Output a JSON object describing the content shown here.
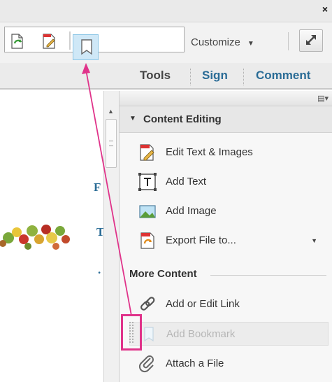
{
  "window": {
    "close_label": "×"
  },
  "toolbar": {
    "customize_label": "Customize",
    "customize_arrow": "▼",
    "icons": [
      "refresh-document-icon",
      "edit-document-icon",
      "bookmark-icon",
      "expand-icon"
    ]
  },
  "tabs": {
    "tools": "Tools",
    "sign": "Sign",
    "comment": "Comment"
  },
  "document": {
    "letters": [
      "F",
      "T",
      "."
    ]
  },
  "panel": {
    "options_icon": "▤▾",
    "content_editing": {
      "title": "Content Editing",
      "items": [
        {
          "label": "Edit Text & Images",
          "icon": "edit-text-images-icon"
        },
        {
          "label": "Add Text",
          "icon": "add-text-icon"
        },
        {
          "label": "Add Image",
          "icon": "add-image-icon"
        },
        {
          "label": "Export File to...",
          "icon": "export-file-icon",
          "has_dropdown": true
        }
      ]
    },
    "more_content": {
      "title": "More Content",
      "items": [
        {
          "label": "Add or Edit Link",
          "icon": "link-icon"
        },
        {
          "label": "Add Bookmark",
          "icon": "bookmark-icon",
          "disabled": true
        },
        {
          "label": "Attach a File",
          "icon": "paperclip-icon"
        }
      ]
    }
  },
  "colors": {
    "accent_blue": "#2a6c96",
    "highlight_pink": "#e0338a",
    "selected_bookmark_bg": "#cfe8f7"
  }
}
